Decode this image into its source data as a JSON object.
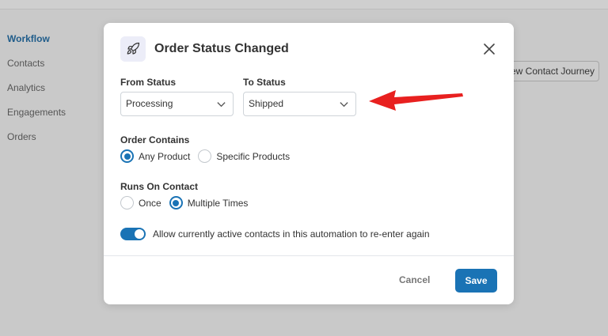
{
  "sidebar": {
    "items": [
      {
        "label": "Workflow"
      },
      {
        "label": "Contacts"
      },
      {
        "label": "Analytics"
      },
      {
        "label": "Engagements"
      },
      {
        "label": "Orders"
      }
    ]
  },
  "header": {
    "journey_button": "ew Contact Journey"
  },
  "modal": {
    "icon": "rocket-icon",
    "title": "Order Status Changed",
    "from_status": {
      "label": "From Status",
      "value": "Processing"
    },
    "to_status": {
      "label": "To Status",
      "value": "Shipped"
    },
    "order_contains": {
      "label": "Order Contains",
      "options": [
        "Any Product",
        "Specific Products"
      ],
      "selected": "Any Product"
    },
    "runs_on_contact": {
      "label": "Runs On Contact",
      "options": [
        "Once",
        "Multiple Times"
      ],
      "selected": "Multiple Times"
    },
    "reenter_toggle": {
      "label": "Allow currently active contacts in this automation to re-enter again",
      "on": true
    },
    "cancel_label": "Cancel",
    "save_label": "Save"
  },
  "colors": {
    "accent": "#1a73b5",
    "annotation_arrow": "#e8201f"
  }
}
